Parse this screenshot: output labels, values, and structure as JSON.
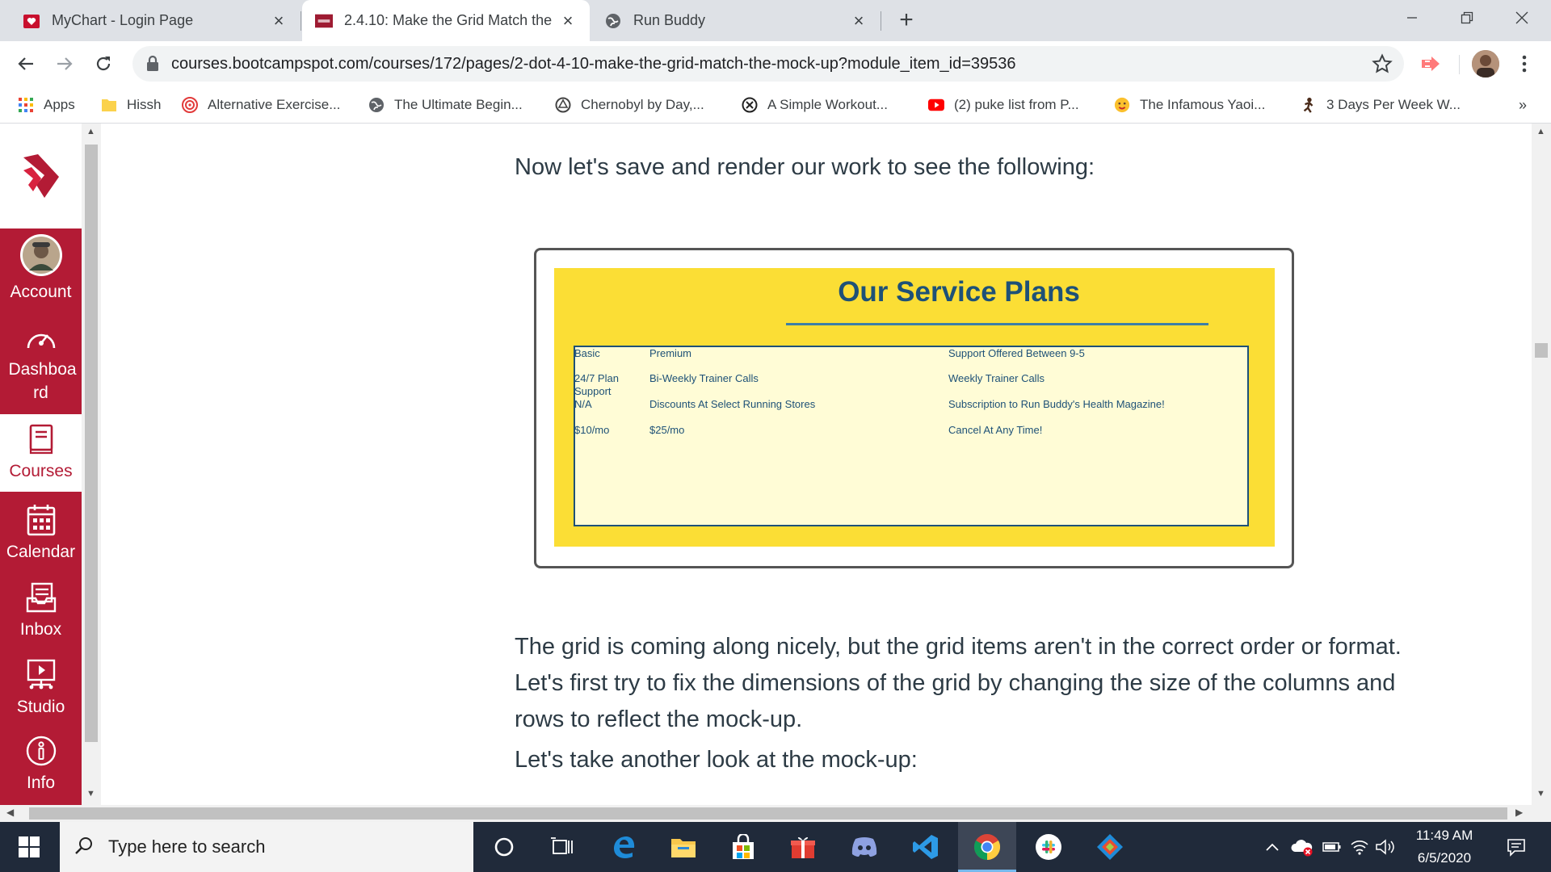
{
  "browser": {
    "tabs": [
      {
        "title": "MyChart - Login Page",
        "icon": "mychart-icon"
      },
      {
        "title": "2.4.10: Make the Grid Match the",
        "icon": "bootcamp-icon"
      },
      {
        "title": "Run Buddy",
        "icon": "globe-icon"
      }
    ],
    "url": "courses.bootcampspot.com/courses/172/pages/2-dot-4-10-make-the-grid-match-the-mock-up?module_item_id=39536",
    "bookmarks": [
      {
        "label": "Apps",
        "icon": "apps-grid-icon"
      },
      {
        "label": "Hissh",
        "icon": "folder-icon"
      },
      {
        "label": "Alternative Exercise...",
        "icon": "target-icon"
      },
      {
        "label": "The Ultimate Begin...",
        "icon": "globe-icon"
      },
      {
        "label": "Chernobyl by Day,...",
        "icon": "chernobyl-icon"
      },
      {
        "label": "A Simple Workout...",
        "icon": "x-circle-icon"
      },
      {
        "label": "(2) puke list from P...",
        "icon": "youtube-icon"
      },
      {
        "label": "The Infamous Yaoi...",
        "icon": "emoji-icon"
      },
      {
        "label": "3 Days Per Week W...",
        "icon": "figure-icon"
      }
    ],
    "more_bookmarks": "»"
  },
  "sidebar": {
    "items": [
      {
        "label": "Account",
        "icon": "avatar"
      },
      {
        "label": "Dashboa rd",
        "icon": "dashboard-icon"
      },
      {
        "label": "Courses",
        "icon": "courses-icon"
      },
      {
        "label": "Calendar",
        "icon": "calendar-icon"
      },
      {
        "label": "Inbox",
        "icon": "inbox-icon"
      },
      {
        "label": "Studio",
        "icon": "studio-icon"
      },
      {
        "label": "Info",
        "icon": "info-icon"
      }
    ]
  },
  "content": {
    "para1": "Now let's save and render our work to see the following:",
    "para2": "The grid is coming along nicely, but the grid items aren't in the correct order or format. Let's first try to fix the dimensions of the grid by changing the size of the columns and rows to reflect the mock-up.",
    "para3": "Let's take another look at the mock-up:",
    "mockup": {
      "title": "Our Service Plans",
      "cells": [
        [
          "Basic",
          "Premium",
          "Support Offered Between 9-5"
        ],
        [
          "24/7 Plan Support",
          "Bi-Weekly Trainer Calls",
          "Weekly Trainer Calls"
        ],
        [
          "N/A",
          "Discounts At Select Running Stores",
          "Subscription to Run Buddy's Health Magazine!"
        ],
        [
          "$10/mo",
          "$25/mo",
          "Cancel At Any Time!"
        ]
      ]
    }
  },
  "taskbar": {
    "search_placeholder": "Type here to search",
    "time": "11:49 AM",
    "date": "6/5/2020"
  },
  "colors": {
    "canvas_red": "#b31b35",
    "mock_yellow": "#fbde35",
    "mock_blue": "#1e5177"
  }
}
